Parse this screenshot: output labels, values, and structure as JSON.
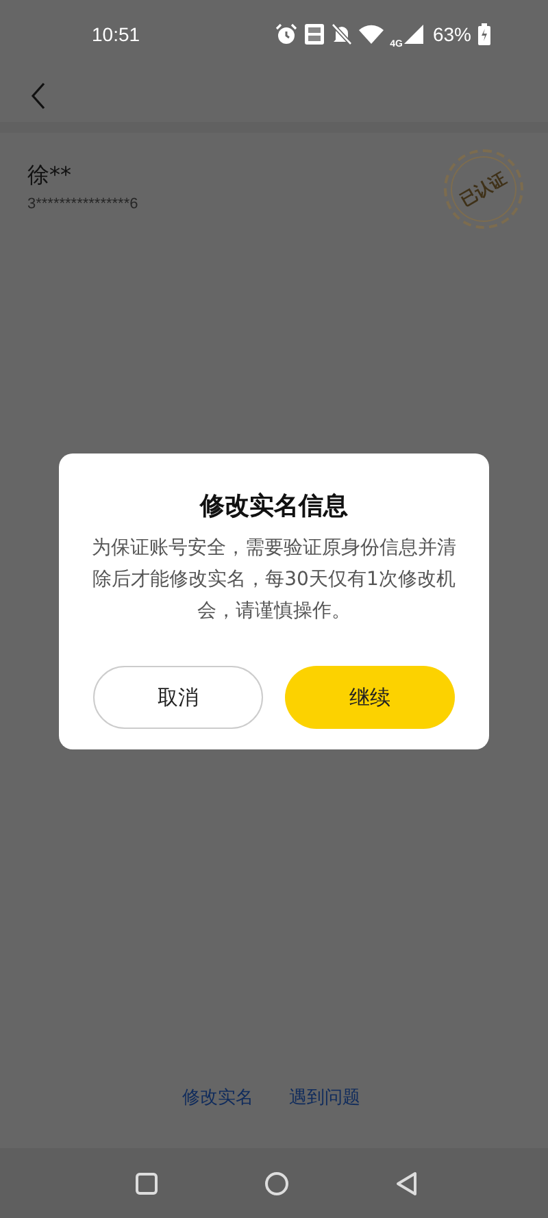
{
  "status_bar": {
    "time": "10:51",
    "network": "4G",
    "battery": "63%"
  },
  "profile": {
    "name": "徐**",
    "id_number": "3****************6",
    "stamp": "已认证"
  },
  "links": [
    "修改实名",
    "遇到问题"
  ],
  "dialog": {
    "title": "修改实名信息",
    "message": "为保证账号安全，需要验证原身份信息并清除后才能修改实名，每30天仅有1次修改机会，请谨慎操作。",
    "buttons": [
      {
        "label": "取消",
        "kind": "secondary"
      },
      {
        "label": "继续",
        "kind": "primary"
      }
    ]
  }
}
